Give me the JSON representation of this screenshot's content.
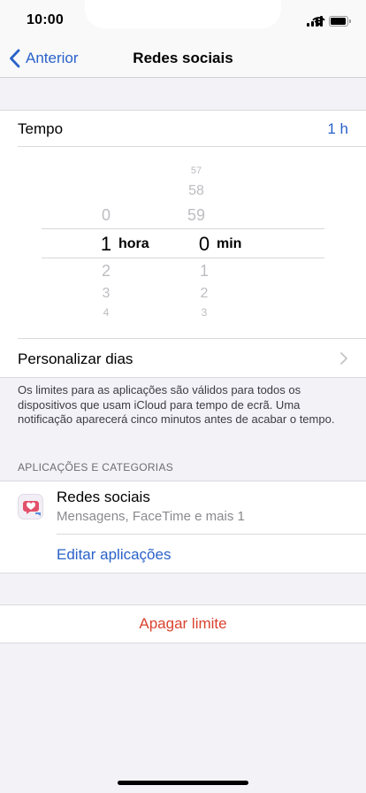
{
  "status_bar": {
    "time": "10:00"
  },
  "nav": {
    "back_label": "Anterior",
    "title": "Redes sociais"
  },
  "tempo": {
    "label": "Tempo",
    "value": "1 h"
  },
  "picker": {
    "hours": {
      "above": [
        "0"
      ],
      "selected": "1",
      "below": [
        "2",
        "3",
        "4"
      ],
      "unit": "hora"
    },
    "minutes": {
      "above": [
        "57",
        "58",
        "59"
      ],
      "selected": "0",
      "below": [
        "1",
        "2",
        "3"
      ],
      "unit": "min"
    }
  },
  "personalizar": {
    "label": "Personalizar dias"
  },
  "footnote": "Os limites para as aplicações são válidos para todos os dispositivos que usam iCloud para tempo de ecrã. Uma notificação aparecerá cinco minutos antes de acabar o tempo.",
  "apps_section": {
    "header": "APLICAÇÕES E CATEGORIAS",
    "item": {
      "title": "Redes sociais",
      "subtitle": "Mensagens, FaceTime e mais 1",
      "icon": "social-bubbles-icon"
    },
    "edit_label": "Editar aplicações"
  },
  "delete_label": "Apagar limite",
  "colors": {
    "accent": "#2a62c9",
    "destructive": "#d9432f",
    "background": "#f2f2f7"
  }
}
